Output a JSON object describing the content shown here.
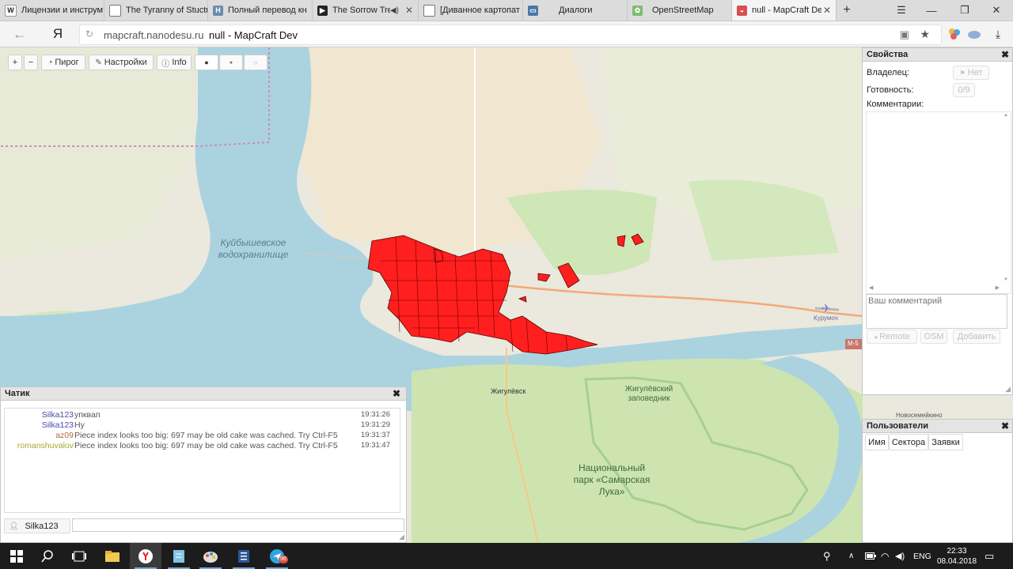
{
  "browser": {
    "tabs": [
      {
        "title": "Лицензии и инструм",
        "favicon": "W",
        "fav_color": "#333333"
      },
      {
        "title": "The Tyranny of Stuctu",
        "favicon": "doc",
        "fav_color": "#666666"
      },
      {
        "title": "Полный перевод кн",
        "favicon": "H",
        "fav_color": "#6a8cb0"
      },
      {
        "title": "The Sorrow Tre",
        "favicon": "play",
        "fav_color": "#222222"
      },
      {
        "title": "[Диванное картопат",
        "favicon": "doc",
        "fav_color": "#666666"
      },
      {
        "title": "Диалоги",
        "favicon": "vk",
        "fav_color": "#4a76a8"
      },
      {
        "title": "OpenStreetMap",
        "favicon": "osm",
        "fav_color": "#7ebc6f"
      },
      {
        "title": "null - MapCraft De",
        "favicon": "cake",
        "fav_color": "#c44"
      }
    ],
    "new_tab": "+",
    "url": "mapcraft.nanodesu.ru",
    "page_title": "null - MapCraft Dev",
    "yandex_logo": "Я"
  },
  "toolbar": {
    "zoom_in": "+",
    "zoom_out": "−",
    "pie_label": "Пирог",
    "settings_label": "Настройки",
    "info_label": "Info",
    "dot_large": "●",
    "dot_medium": "●",
    "dot_small": "○"
  },
  "map": {
    "labels": {
      "reservoir_line1": "Куйбышевское",
      "reservoir_line2": "водохранилище",
      "zhigulevsk": "Жигулёвск",
      "reserve_line1": "Жигулёвский",
      "reserve_line2": "заповедник",
      "park_line1": "Национальный",
      "park_line2": "парк «Самарская",
      "park_line3": "Лука»",
      "kurumoch": "Курумоч",
      "m5": "M-5",
      "novosemeikino": "Новосемейкино"
    },
    "colors": {
      "water": "#aad3df",
      "forest": "#cce3b0",
      "land": "#ece9e0",
      "pieces": "#ff1f1f",
      "boundary": "#c98fb3"
    }
  },
  "properties": {
    "title": "Свойства",
    "owner_label": "Владелец:",
    "owner_button": "Нет",
    "readiness_label": "Готовность:",
    "readiness_value": "0/9",
    "comments_label": "Комментарии:",
    "comment_placeholder": "Ваш комментарий",
    "remote_button": "Remote",
    "osm_button": "OSM",
    "add_button": "Добавить"
  },
  "users": {
    "title": "Пользователи",
    "tabs": [
      "Имя",
      "Сектора",
      "Заявки"
    ]
  },
  "chat": {
    "title": "Чатик",
    "messages": [
      {
        "nick": "Silka123",
        "text": "упквап",
        "time": "19:31:26",
        "color": "#4a4aa8"
      },
      {
        "nick": "Silka123",
        "text": "Ну",
        "time": "19:31:29",
        "color": "#4a4aa8"
      },
      {
        "nick": "az09",
        "text": "Piece index looks too big: 697 may be old cake was cached. Try Ctrl-F5",
        "time": "19:31:37",
        "color": "#b06a3a"
      },
      {
        "nick": "romanshuvalov",
        "text": "Piece index looks too big: 697 may be old cake was cached. Try Ctrl-F5",
        "time": "19:31:47",
        "color": "#a8a830"
      }
    ],
    "current_user": "Silka123"
  },
  "taskbar": {
    "language": "ENG",
    "time": "22:33",
    "date": "08.04.2018",
    "telegram_badge": "96"
  }
}
